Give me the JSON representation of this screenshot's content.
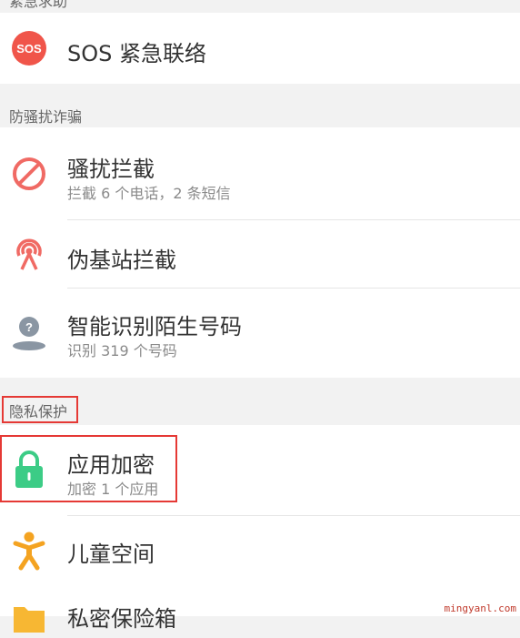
{
  "sections": {
    "emergency": "紧急求助",
    "anti_harassment": "防骚扰诈骗",
    "privacy": "隐私保护"
  },
  "items": {
    "sos": {
      "icon_text": "SOS",
      "title": "SOS 紧急联络"
    },
    "harassment": {
      "title": "骚扰拦截",
      "subtitle": "拦截 6 个电话，2 条短信"
    },
    "fake_base_station": {
      "title": "伪基站拦截"
    },
    "identify_number": {
      "title": "智能识别陌生号码",
      "subtitle": "识别 319 个号码"
    },
    "app_lock": {
      "title": "应用加密",
      "subtitle": "加密 1 个应用"
    },
    "kids_space": {
      "title": "儿童空间"
    },
    "privacy_safe": {
      "title": "私密保险箱"
    }
  },
  "watermark": "mingyanl.com",
  "colors": {
    "sos_red": "#f0554a",
    "block_red": "#f06a64",
    "antenna_red": "#f06a64",
    "person_gray": "#8a96a3",
    "lock_green": "#3ccc86",
    "kids_orange": "#f4a321",
    "folder_yellow": "#f7b733",
    "highlight_red": "#e53935"
  }
}
